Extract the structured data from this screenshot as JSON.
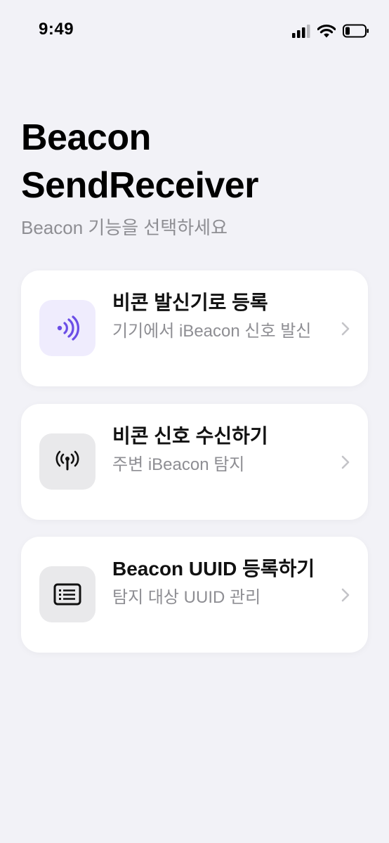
{
  "status_bar": {
    "time": "9:49"
  },
  "header": {
    "title": "Beacon SendReceiver",
    "subtitle": "Beacon 기능을 선택하세요"
  },
  "menu": {
    "items": [
      {
        "title": "비콘 발신기로 등록",
        "description": "기기에서 iBeacon 신호 발신",
        "icon": "broadcast-icon",
        "icon_bg": "#efecfd",
        "icon_color": "#6b4ee6"
      },
      {
        "title": "비콘 신호 수신하기",
        "description": "주변 iBeacon 탐지",
        "icon": "antenna-icon",
        "icon_bg": "#e9e9eb",
        "icon_color": "#111111"
      },
      {
        "title": "Beacon UUID 등록하기",
        "description": "탐지 대상 UUID 관리",
        "icon": "list-icon",
        "icon_bg": "#e9e9eb",
        "icon_color": "#111111"
      }
    ]
  }
}
